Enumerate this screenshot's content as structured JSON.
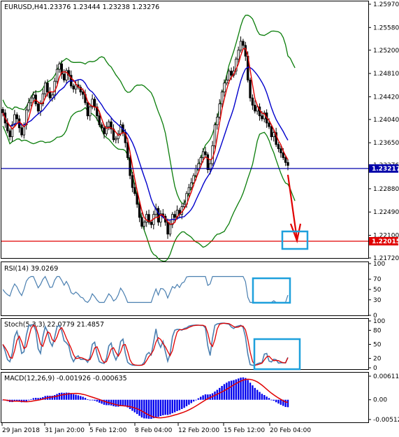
{
  "header": {
    "symbol": "EURUSD,H4",
    "ohlc": "1.23376 1.23444 1.23238 1.23276"
  },
  "price_axis": [
    "1.25970",
    "1.25580",
    "1.25200",
    "1.24810",
    "1.24420",
    "1.24040",
    "1.23650",
    "1.23276",
    "1.22880",
    "1.22490",
    "1.22100",
    "1.21720"
  ],
  "price_tags": {
    "current_blue": "1.23217",
    "target_red": "1.22015"
  },
  "rsi": {
    "title": "RSI(14) 39.0269",
    "axis": [
      "100",
      "70",
      "50",
      "30",
      "0"
    ]
  },
  "stoch": {
    "title": "Stoch(5,3,3) 22.0779 21.4857",
    "axis": [
      "100",
      "80",
      "50",
      "20",
      "0"
    ]
  },
  "macd": {
    "title": "MACD(12,26,9) -0.001926 -0.000635",
    "axis": [
      "0.006114",
      "0.00",
      "-0.005126"
    ]
  },
  "time_axis": [
    "29 Jan 2018",
    "31 Jan 20:00",
    "5 Feb 12:00",
    "8 Feb 04:00",
    "12 Feb 20:00",
    "15 Feb 12:00",
    "20 Feb 04:00"
  ],
  "colors": {
    "candle": "#000000",
    "bb": "#0a7d0a",
    "ma_fast": "#e00000",
    "ma_slow": "#0000cc",
    "hline_blue": "#0000aa",
    "hline_red": "#e00000",
    "rsi_line": "#4a7fb0",
    "stoch_main": "#4a7fb0",
    "stoch_signal": "#e00000",
    "macd_hist": "#0000ee",
    "macd_signal": "#e00000",
    "highlight": "#1ea0dc"
  },
  "chart_data": {
    "type": "candlestick",
    "symbol": "EURUSD",
    "timeframe": "H4",
    "last_close": 1.23276,
    "ylim": [
      1.2172,
      1.2597
    ],
    "close": [
      1.2415,
      1.2398,
      1.2385,
      1.2375,
      1.2395,
      1.2412,
      1.2405,
      1.239,
      1.2378,
      1.2395,
      1.242,
      1.2432,
      1.244,
      1.2445,
      1.243,
      1.2418,
      1.243,
      1.2447,
      1.2465,
      1.245,
      1.244,
      1.2445,
      1.2468,
      1.2488,
      1.2497,
      1.248,
      1.247,
      1.2486,
      1.2478,
      1.246,
      1.2455,
      1.2462,
      1.2458,
      1.245,
      1.2446,
      1.2432,
      1.241,
      1.2425,
      1.2438,
      1.2425,
      1.241,
      1.2395,
      1.239,
      1.238,
      1.2392,
      1.24,
      1.2388,
      1.237,
      1.2372,
      1.238,
      1.2395,
      1.2382,
      1.2365,
      1.234,
      1.231,
      1.229,
      1.228,
      1.2262,
      1.224,
      1.2225,
      1.2232,
      1.2245,
      1.2232,
      1.2228,
      1.2245,
      1.2255,
      1.2232,
      1.2246,
      1.2242,
      1.2232,
      1.2212,
      1.2228,
      1.2245,
      1.224,
      1.2252,
      1.2245,
      1.2258,
      1.2262,
      1.228,
      1.229,
      1.2298,
      1.231,
      1.2322,
      1.233,
      1.234,
      1.235,
      1.2345,
      1.232,
      1.233,
      1.236,
      1.2395,
      1.2408,
      1.243,
      1.245,
      1.2465,
      1.247,
      1.2485,
      1.2478,
      1.2485,
      1.2505,
      1.252,
      1.2535,
      1.2528,
      1.251,
      1.247,
      1.244,
      1.2428,
      1.2418,
      1.2425,
      1.241,
      1.2405,
      1.2415,
      1.2398,
      1.2392,
      1.2375,
      1.2382,
      1.2362,
      1.2355,
      1.2348,
      1.234,
      1.2332,
      1.2327
    ],
    "key_levels": [
      1.23217,
      1.22015
    ],
    "rsi_last": 39.0269,
    "stoch_last": [
      22.0779,
      21.4857
    ],
    "macd_last": [
      -0.001926,
      -0.000635
    ]
  }
}
